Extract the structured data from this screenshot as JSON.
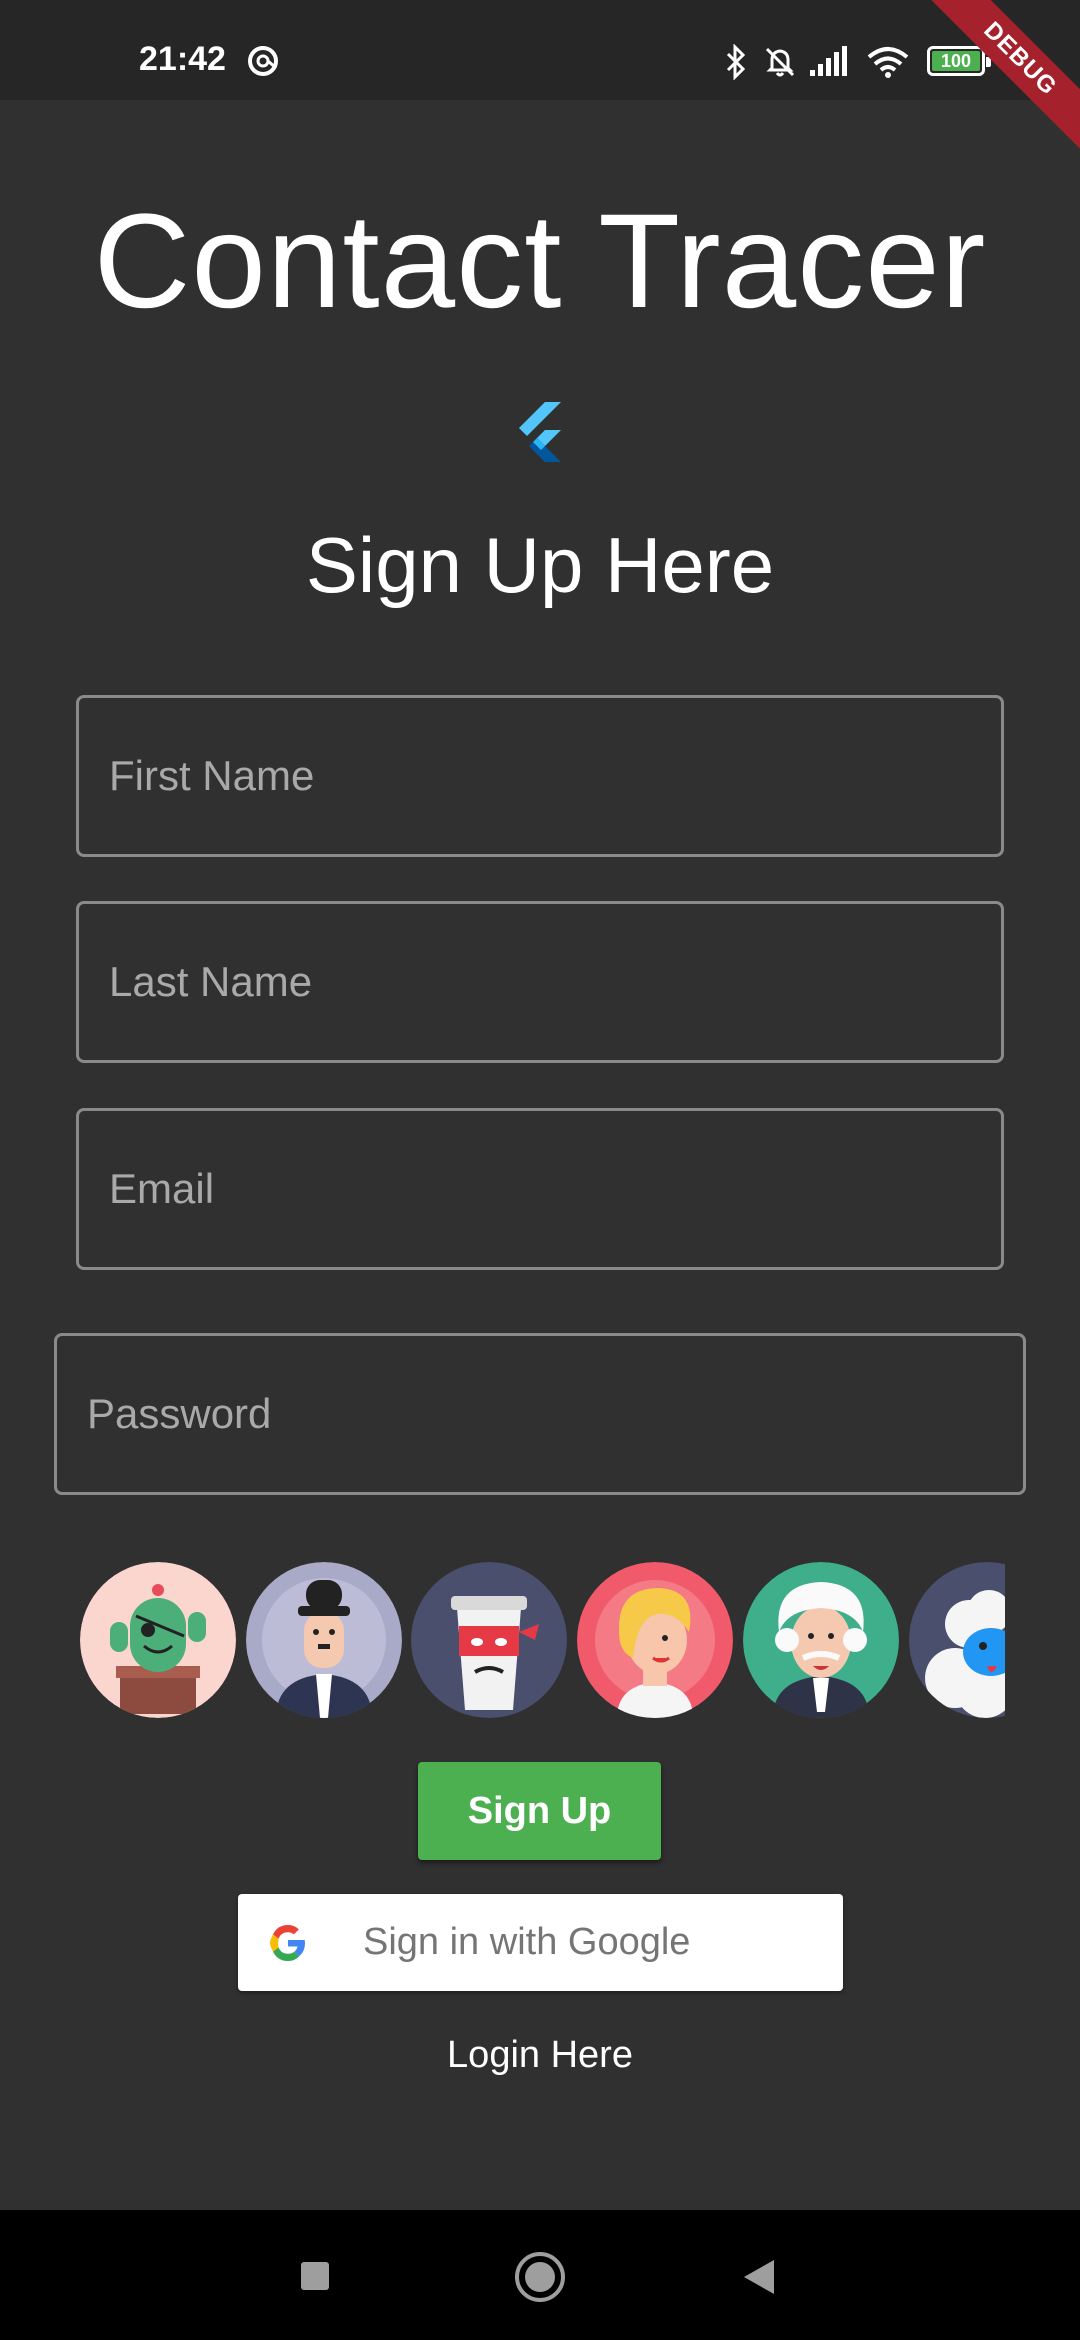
{
  "status_bar": {
    "time": "21:42",
    "icons": [
      "at-sign-icon",
      "bluetooth-icon",
      "alarm-off-icon",
      "signal-icon",
      "wifi-icon",
      "battery-icon"
    ],
    "battery_level": "100",
    "debug_label": "DEBUG"
  },
  "header": {
    "title": "Contact Tracer",
    "logo_icon": "flutter-logo-icon",
    "subtitle": "Sign Up Here"
  },
  "form": {
    "first_name_placeholder": "First Name",
    "last_name_placeholder": "Last Name",
    "email_placeholder": "Email",
    "password_placeholder": "Password"
  },
  "avatars": [
    "cactus-pirate-avatar",
    "gentleman-bowler-avatar",
    "coffee-cup-ninja-avatar",
    "blonde-woman-avatar",
    "old-scientist-avatar",
    "sheep-avatar"
  ],
  "actions": {
    "signup_label": "Sign Up",
    "google_label": "Sign in with Google",
    "login_label": "Login Here"
  },
  "nav": {
    "icons": [
      "recents-square-icon",
      "home-circle-icon",
      "back-triangle-icon"
    ]
  },
  "colors": {
    "background": "#303030",
    "accent_green": "#4caf50",
    "debug_red": "#a5212b"
  }
}
